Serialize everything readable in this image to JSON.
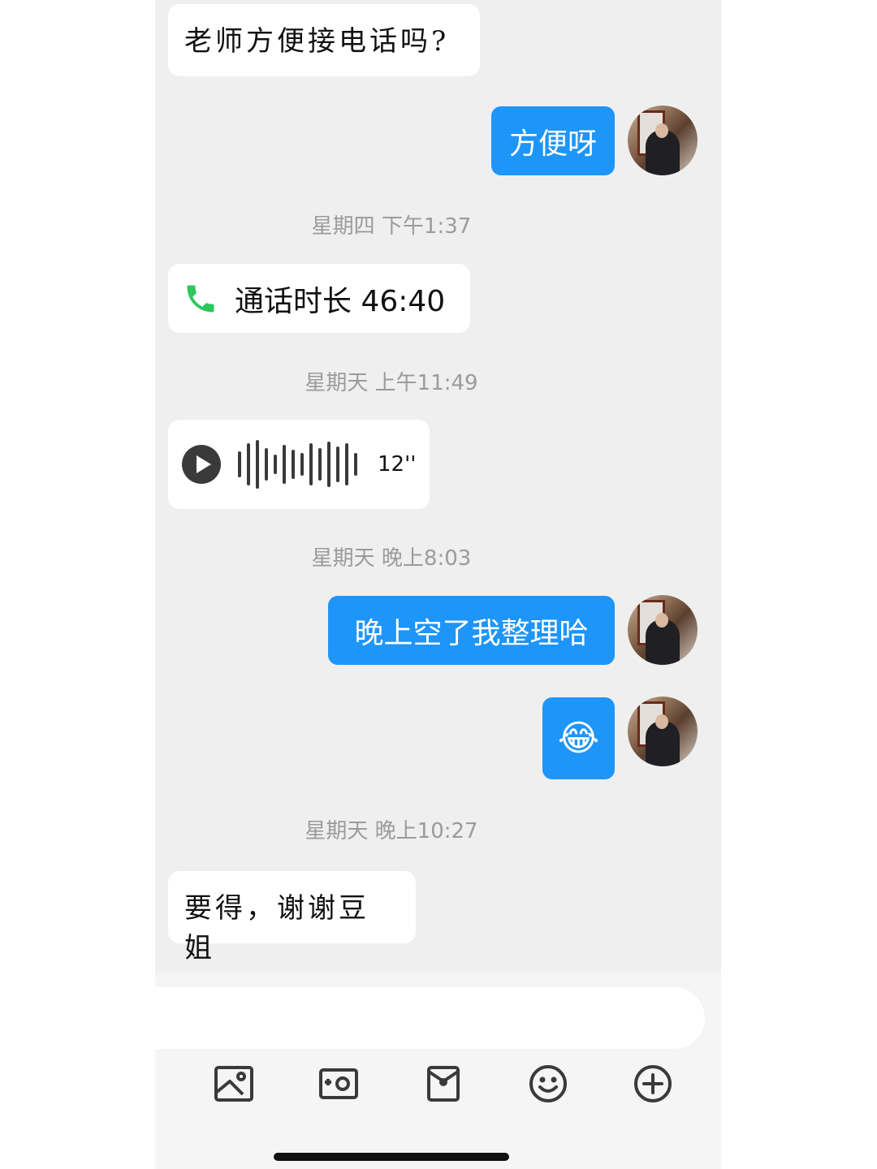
{
  "messages": {
    "m1": "老师方便接电话吗?",
    "m2": "方便呀",
    "call_label": "通话时长 46:40",
    "voice_duration": "12''",
    "m3": "晚上空了我整理哈",
    "m4_emoji": "😂",
    "m5": "要得，谢谢豆姐"
  },
  "timestamps": {
    "t1": "星期四 下午1:37",
    "t2": "星期天 上午11:49",
    "t3": "星期天 晚上8:03",
    "t4": "星期天 晚上10:27"
  },
  "input": {
    "placeholder": ""
  },
  "toolbar_icons": [
    "image-icon",
    "camera-icon",
    "gift-icon",
    "emoji-icon",
    "plus-icon"
  ],
  "colors": {
    "outgoing_bubble": "#1e95f8",
    "call_icon": "#2dc85b",
    "timestamp": "#9b9b9b"
  }
}
